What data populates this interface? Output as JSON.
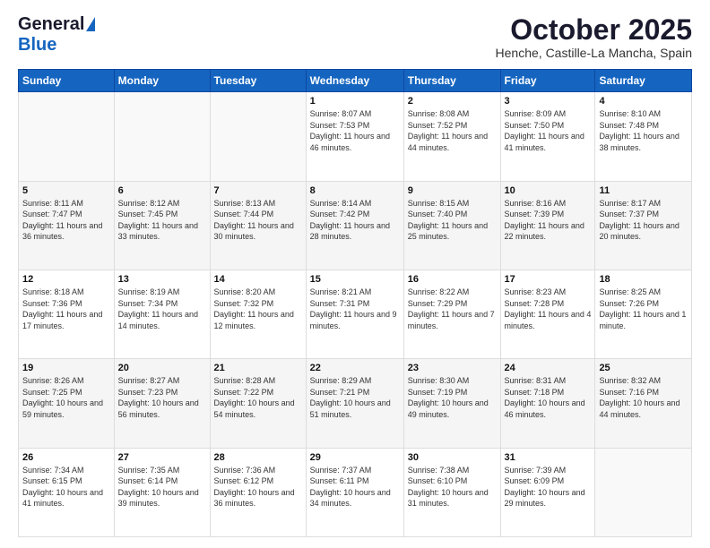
{
  "header": {
    "logo_general": "General",
    "logo_blue": "Blue",
    "title": "October 2025",
    "location": "Henche, Castille-La Mancha, Spain"
  },
  "days_of_week": [
    "Sunday",
    "Monday",
    "Tuesday",
    "Wednesday",
    "Thursday",
    "Friday",
    "Saturday"
  ],
  "weeks": [
    [
      {
        "day": "",
        "sunrise": "",
        "sunset": "",
        "daylight": ""
      },
      {
        "day": "",
        "sunrise": "",
        "sunset": "",
        "daylight": ""
      },
      {
        "day": "",
        "sunrise": "",
        "sunset": "",
        "daylight": ""
      },
      {
        "day": "1",
        "sunrise": "Sunrise: 8:07 AM",
        "sunset": "Sunset: 7:53 PM",
        "daylight": "Daylight: 11 hours and 46 minutes."
      },
      {
        "day": "2",
        "sunrise": "Sunrise: 8:08 AM",
        "sunset": "Sunset: 7:52 PM",
        "daylight": "Daylight: 11 hours and 44 minutes."
      },
      {
        "day": "3",
        "sunrise": "Sunrise: 8:09 AM",
        "sunset": "Sunset: 7:50 PM",
        "daylight": "Daylight: 11 hours and 41 minutes."
      },
      {
        "day": "4",
        "sunrise": "Sunrise: 8:10 AM",
        "sunset": "Sunset: 7:48 PM",
        "daylight": "Daylight: 11 hours and 38 minutes."
      }
    ],
    [
      {
        "day": "5",
        "sunrise": "Sunrise: 8:11 AM",
        "sunset": "Sunset: 7:47 PM",
        "daylight": "Daylight: 11 hours and 36 minutes."
      },
      {
        "day": "6",
        "sunrise": "Sunrise: 8:12 AM",
        "sunset": "Sunset: 7:45 PM",
        "daylight": "Daylight: 11 hours and 33 minutes."
      },
      {
        "day": "7",
        "sunrise": "Sunrise: 8:13 AM",
        "sunset": "Sunset: 7:44 PM",
        "daylight": "Daylight: 11 hours and 30 minutes."
      },
      {
        "day": "8",
        "sunrise": "Sunrise: 8:14 AM",
        "sunset": "Sunset: 7:42 PM",
        "daylight": "Daylight: 11 hours and 28 minutes."
      },
      {
        "day": "9",
        "sunrise": "Sunrise: 8:15 AM",
        "sunset": "Sunset: 7:40 PM",
        "daylight": "Daylight: 11 hours and 25 minutes."
      },
      {
        "day": "10",
        "sunrise": "Sunrise: 8:16 AM",
        "sunset": "Sunset: 7:39 PM",
        "daylight": "Daylight: 11 hours and 22 minutes."
      },
      {
        "day": "11",
        "sunrise": "Sunrise: 8:17 AM",
        "sunset": "Sunset: 7:37 PM",
        "daylight": "Daylight: 11 hours and 20 minutes."
      }
    ],
    [
      {
        "day": "12",
        "sunrise": "Sunrise: 8:18 AM",
        "sunset": "Sunset: 7:36 PM",
        "daylight": "Daylight: 11 hours and 17 minutes."
      },
      {
        "day": "13",
        "sunrise": "Sunrise: 8:19 AM",
        "sunset": "Sunset: 7:34 PM",
        "daylight": "Daylight: 11 hours and 14 minutes."
      },
      {
        "day": "14",
        "sunrise": "Sunrise: 8:20 AM",
        "sunset": "Sunset: 7:32 PM",
        "daylight": "Daylight: 11 hours and 12 minutes."
      },
      {
        "day": "15",
        "sunrise": "Sunrise: 8:21 AM",
        "sunset": "Sunset: 7:31 PM",
        "daylight": "Daylight: 11 hours and 9 minutes."
      },
      {
        "day": "16",
        "sunrise": "Sunrise: 8:22 AM",
        "sunset": "Sunset: 7:29 PM",
        "daylight": "Daylight: 11 hours and 7 minutes."
      },
      {
        "day": "17",
        "sunrise": "Sunrise: 8:23 AM",
        "sunset": "Sunset: 7:28 PM",
        "daylight": "Daylight: 11 hours and 4 minutes."
      },
      {
        "day": "18",
        "sunrise": "Sunrise: 8:25 AM",
        "sunset": "Sunset: 7:26 PM",
        "daylight": "Daylight: 11 hours and 1 minute."
      }
    ],
    [
      {
        "day": "19",
        "sunrise": "Sunrise: 8:26 AM",
        "sunset": "Sunset: 7:25 PM",
        "daylight": "Daylight: 10 hours and 59 minutes."
      },
      {
        "day": "20",
        "sunrise": "Sunrise: 8:27 AM",
        "sunset": "Sunset: 7:23 PM",
        "daylight": "Daylight: 10 hours and 56 minutes."
      },
      {
        "day": "21",
        "sunrise": "Sunrise: 8:28 AM",
        "sunset": "Sunset: 7:22 PM",
        "daylight": "Daylight: 10 hours and 54 minutes."
      },
      {
        "day": "22",
        "sunrise": "Sunrise: 8:29 AM",
        "sunset": "Sunset: 7:21 PM",
        "daylight": "Daylight: 10 hours and 51 minutes."
      },
      {
        "day": "23",
        "sunrise": "Sunrise: 8:30 AM",
        "sunset": "Sunset: 7:19 PM",
        "daylight": "Daylight: 10 hours and 49 minutes."
      },
      {
        "day": "24",
        "sunrise": "Sunrise: 8:31 AM",
        "sunset": "Sunset: 7:18 PM",
        "daylight": "Daylight: 10 hours and 46 minutes."
      },
      {
        "day": "25",
        "sunrise": "Sunrise: 8:32 AM",
        "sunset": "Sunset: 7:16 PM",
        "daylight": "Daylight: 10 hours and 44 minutes."
      }
    ],
    [
      {
        "day": "26",
        "sunrise": "Sunrise: 7:34 AM",
        "sunset": "Sunset: 6:15 PM",
        "daylight": "Daylight: 10 hours and 41 minutes."
      },
      {
        "day": "27",
        "sunrise": "Sunrise: 7:35 AM",
        "sunset": "Sunset: 6:14 PM",
        "daylight": "Daylight: 10 hours and 39 minutes."
      },
      {
        "day": "28",
        "sunrise": "Sunrise: 7:36 AM",
        "sunset": "Sunset: 6:12 PM",
        "daylight": "Daylight: 10 hours and 36 minutes."
      },
      {
        "day": "29",
        "sunrise": "Sunrise: 7:37 AM",
        "sunset": "Sunset: 6:11 PM",
        "daylight": "Daylight: 10 hours and 34 minutes."
      },
      {
        "day": "30",
        "sunrise": "Sunrise: 7:38 AM",
        "sunset": "Sunset: 6:10 PM",
        "daylight": "Daylight: 10 hours and 31 minutes."
      },
      {
        "day": "31",
        "sunrise": "Sunrise: 7:39 AM",
        "sunset": "Sunset: 6:09 PM",
        "daylight": "Daylight: 10 hours and 29 minutes."
      },
      {
        "day": "",
        "sunrise": "",
        "sunset": "",
        "daylight": ""
      }
    ]
  ]
}
